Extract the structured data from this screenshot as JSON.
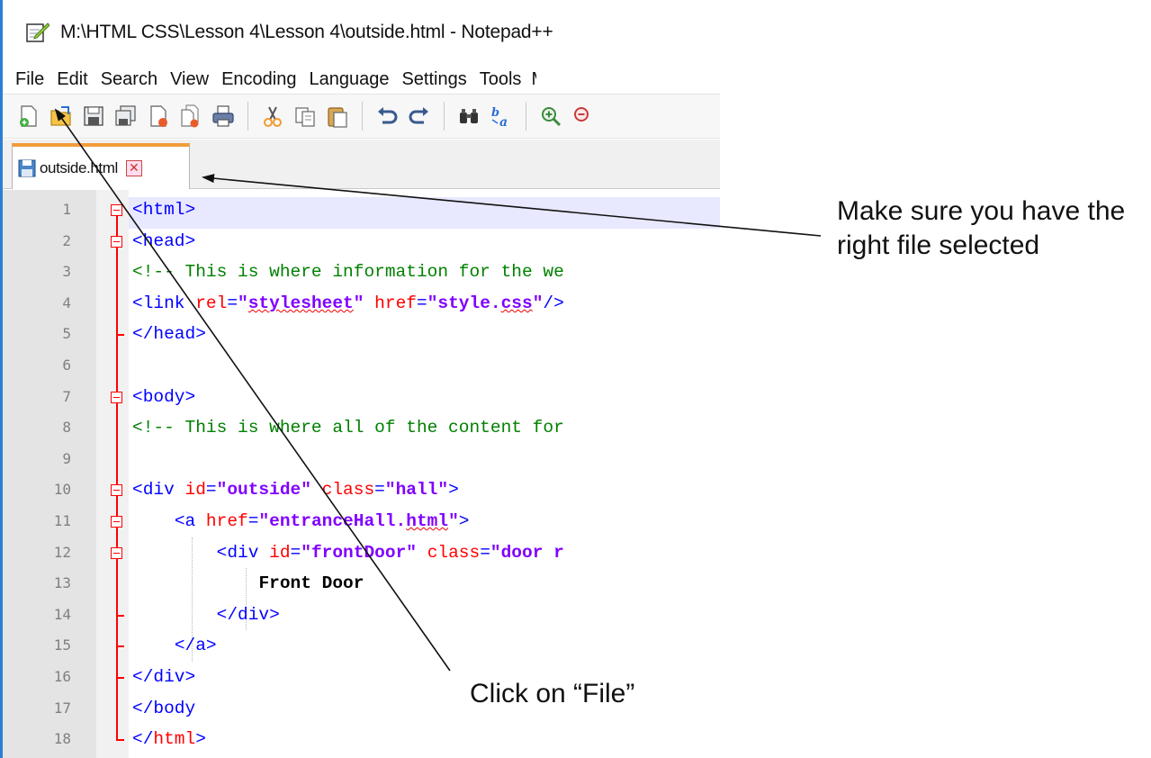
{
  "window": {
    "title": "M:\\HTML CSS\\Lesson 4\\Lesson 4\\outside.html - Notepad++"
  },
  "menu": {
    "items": [
      "File",
      "Edit",
      "Search",
      "View",
      "Encoding",
      "Language",
      "Settings",
      "Tools",
      "M"
    ]
  },
  "toolbar": {
    "icons": [
      "new-file-icon",
      "open-file-icon",
      "save-icon",
      "save-all-icon",
      "close-icon",
      "close-all-icon",
      "print-icon",
      "cut-icon",
      "copy-icon",
      "paste-icon",
      "undo-icon",
      "redo-icon",
      "find-icon",
      "replace-icon",
      "zoom-in-icon",
      "zoom-out-icon"
    ]
  },
  "tab": {
    "label": "outside.html",
    "close_glyph": "✕"
  },
  "editor": {
    "line_numbers": [
      "1",
      "2",
      "3",
      "4",
      "5",
      "6",
      "7",
      "8",
      "9",
      "10",
      "11",
      "12",
      "13",
      "14",
      "15",
      "16",
      "17",
      "18"
    ],
    "lines": [
      [
        {
          "c": "t-tag",
          "t": "<html>"
        }
      ],
      [
        {
          "c": "t-tag",
          "t": "<head>"
        }
      ],
      [
        {
          "c": "t-cmt",
          "t": "<!-- This is where information for the we"
        }
      ],
      [
        {
          "c": "t-tag",
          "t": "<link "
        },
        {
          "c": "t-attr",
          "t": "rel"
        },
        {
          "c": "t-tag",
          "t": "="
        },
        {
          "c": "t-val",
          "t": "\""
        },
        {
          "c": "t-val t-err",
          "t": "stylesheet"
        },
        {
          "c": "t-val",
          "t": "\""
        },
        {
          "c": "t-tag",
          "t": " "
        },
        {
          "c": "t-attr",
          "t": "href"
        },
        {
          "c": "t-tag",
          "t": "="
        },
        {
          "c": "t-val",
          "t": "\"style."
        },
        {
          "c": "t-val t-err",
          "t": "css"
        },
        {
          "c": "t-val",
          "t": "\""
        },
        {
          "c": "t-tag",
          "t": "/>"
        }
      ],
      [
        {
          "c": "t-tag",
          "t": "</head>"
        }
      ],
      [],
      [
        {
          "c": "t-tag",
          "t": "<body>"
        }
      ],
      [
        {
          "c": "t-cmt",
          "t": "<!-- This is where all of the content for"
        }
      ],
      [],
      [
        {
          "c": "t-tag",
          "t": "<div "
        },
        {
          "c": "t-attr",
          "t": "id"
        },
        {
          "c": "t-tag",
          "t": "="
        },
        {
          "c": "t-val",
          "t": "\"outside\""
        },
        {
          "c": "t-tag",
          "t": " "
        },
        {
          "c": "t-attr",
          "t": "class"
        },
        {
          "c": "t-tag",
          "t": "="
        },
        {
          "c": "t-val",
          "t": "\"hall\""
        },
        {
          "c": "t-tag",
          "t": ">"
        }
      ],
      [
        {
          "c": "",
          "t": "    "
        },
        {
          "c": "t-tag",
          "t": "<a "
        },
        {
          "c": "t-attr",
          "t": "href"
        },
        {
          "c": "t-tag",
          "t": "="
        },
        {
          "c": "t-val",
          "t": "\"entranceHall."
        },
        {
          "c": "t-val t-err",
          "t": "html"
        },
        {
          "c": "t-val",
          "t": "\""
        },
        {
          "c": "t-tag",
          "t": ">"
        }
      ],
      [
        {
          "c": "",
          "t": "        "
        },
        {
          "c": "t-tag",
          "t": "<div "
        },
        {
          "c": "t-attr",
          "t": "id"
        },
        {
          "c": "t-tag",
          "t": "="
        },
        {
          "c": "t-val",
          "t": "\"frontDoor\""
        },
        {
          "c": "t-tag",
          "t": " "
        },
        {
          "c": "t-attr",
          "t": "class"
        },
        {
          "c": "t-tag",
          "t": "="
        },
        {
          "c": "t-val",
          "t": "\"door r"
        }
      ],
      [
        {
          "c": "",
          "t": "            "
        },
        {
          "c": "t-bold",
          "t": "Front Door"
        }
      ],
      [
        {
          "c": "",
          "t": "        "
        },
        {
          "c": "t-tag",
          "t": "</div>"
        }
      ],
      [
        {
          "c": "",
          "t": "    "
        },
        {
          "c": "t-tag",
          "t": "</a>"
        }
      ],
      [
        {
          "c": "t-tag",
          "t": "</div>"
        }
      ],
      [
        {
          "c": "t-tag",
          "t": "</body"
        }
      ],
      [
        {
          "c": "t-tag",
          "t": "</"
        },
        {
          "c": "t-htmlred",
          "t": "html"
        },
        {
          "c": "t-tag",
          "t": ">"
        }
      ]
    ]
  },
  "annotations": {
    "file_selected": "Make sure you have the right file selected",
    "click_file": "Click on “File”"
  },
  "colors": {
    "accent_tab": "#f39c3a",
    "fold_tree": "#ff0000",
    "window_border": "#2a7fd4"
  }
}
